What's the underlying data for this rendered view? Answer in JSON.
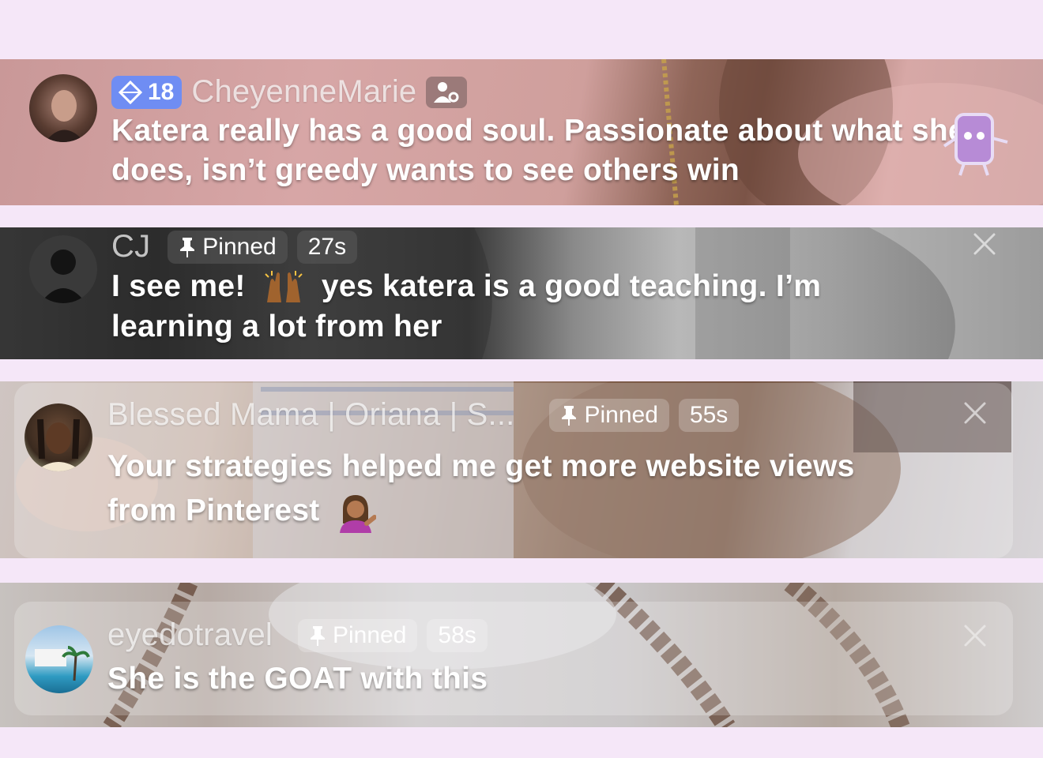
{
  "comments": [
    {
      "username": "CheyenneMarie",
      "level": "18",
      "message": "Katera really has a good soul. Passionate about what she does, isn’t greedy wants to see others win"
    },
    {
      "username": "CJ",
      "pinned_label": "Pinned",
      "time": "27s",
      "message_part1": "I see me!",
      "message_part2": "yes katera is a good teaching. I’m",
      "message_part3": "learning a lot from her"
    },
    {
      "username": "Blessed Mama | Oriana | S...",
      "pinned_label": "Pinned",
      "time": "55s",
      "message_line1": "Your strategies helped me get more website views",
      "message_line2": "from Pinterest"
    },
    {
      "username": "eyedotravel",
      "pinned_label": "Pinned",
      "time": "58s",
      "message": "She is the GOAT with this"
    }
  ],
  "icons": {
    "level_badge": "diamond-icon",
    "moderator": "moderator-icon",
    "pin": "pin-icon",
    "close": "close-icon"
  },
  "colors": {
    "background": "#f5e7f8",
    "level_badge": "#6f8df3"
  }
}
